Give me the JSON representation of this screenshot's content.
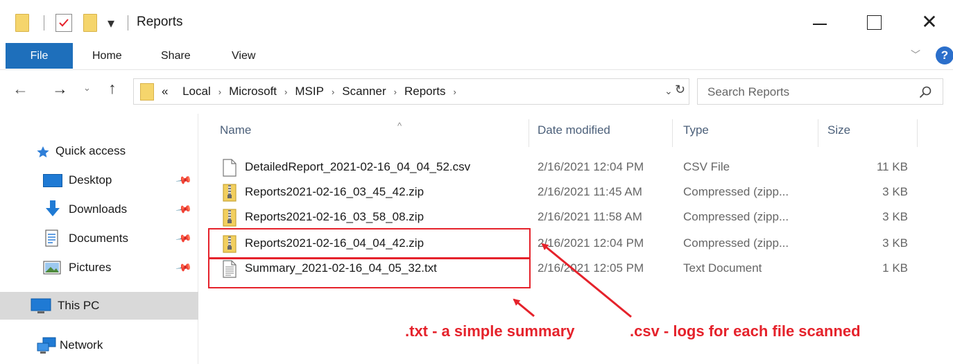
{
  "window": {
    "title": "Reports",
    "minimize_icon": "minimize-icon",
    "maximize_icon": "maximize-icon",
    "close_glyph": "✕"
  },
  "ribbon": {
    "tabs": [
      "File",
      "Home",
      "Share",
      "View"
    ],
    "help_glyph": "?"
  },
  "address": {
    "overflow": "«",
    "crumbs": [
      "Local",
      "Microsoft",
      "MSIP",
      "Scanner",
      "Reports"
    ],
    "separator": "›"
  },
  "search": {
    "placeholder": "Search Reports"
  },
  "nav": {
    "items": [
      {
        "label": "Quick access",
        "icon": "star-icon",
        "pinned": false
      },
      {
        "label": "Desktop",
        "icon": "desktop-icon",
        "pinned": true
      },
      {
        "label": "Downloads",
        "icon": "downloads-icon",
        "pinned": true
      },
      {
        "label": "Documents",
        "icon": "documents-icon",
        "pinned": true
      },
      {
        "label": "Pictures",
        "icon": "pictures-icon",
        "pinned": true
      },
      {
        "label": "This PC",
        "icon": "computer-icon",
        "pinned": false,
        "selected": true
      },
      {
        "label": "Network",
        "icon": "network-icon",
        "pinned": false
      }
    ]
  },
  "columns": {
    "name": "Name",
    "date": "Date modified",
    "type": "Type",
    "size": "Size"
  },
  "files": [
    {
      "name": "DetailedReport_2021-02-16_04_04_52.csv",
      "date": "2/16/2021 12:04 PM",
      "type": "CSV File",
      "size": "11 KB",
      "icon": "csv-file-icon"
    },
    {
      "name": "Reports2021-02-16_03_45_42.zip",
      "date": "2/16/2021 11:45 AM",
      "type": "Compressed (zipp...",
      "size": "3 KB",
      "icon": "zip-file-icon"
    },
    {
      "name": "Reports2021-02-16_03_58_08.zip",
      "date": "2/16/2021 11:58 AM",
      "type": "Compressed (zipp...",
      "size": "3 KB",
      "icon": "zip-file-icon"
    },
    {
      "name": "Reports2021-02-16_04_04_42.zip",
      "date": "2/16/2021 12:04 PM",
      "type": "Compressed (zipp...",
      "size": "3 KB",
      "icon": "zip-file-icon"
    },
    {
      "name": "Summary_2021-02-16_04_05_32.txt",
      "date": "2/16/2021 12:05 PM",
      "type": "Text Document",
      "size": "1 KB",
      "icon": "txt-file-icon"
    }
  ],
  "annotations": {
    "txt_label": ".txt - a simple summary",
    "csv_label": ".csv - logs for each file scanned",
    "color": "#e5222b"
  },
  "colors": {
    "file_tab": "#1e6fbb",
    "folder": "#f5d56c",
    "selected_nav": "#d9d9d9"
  }
}
